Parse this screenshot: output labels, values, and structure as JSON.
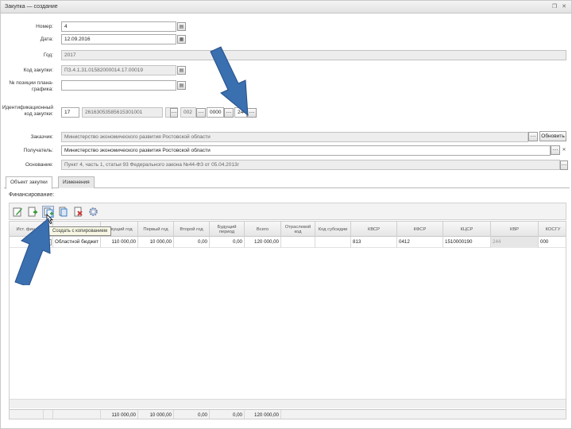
{
  "window": {
    "title": "Закупка — создание",
    "restore_glyph": "❐",
    "close_glyph": "✕"
  },
  "form": {
    "number": {
      "label": "Номер:",
      "value": "4"
    },
    "date": {
      "label": "Дата:",
      "value": "12.09.2016"
    },
    "year": {
      "label": "Год:",
      "value": "2017"
    },
    "purchase_code": {
      "label": "Код закупки:",
      "value": "ПЗ.4.1.31.01582000014.17.00019"
    },
    "schedule_no": {
      "label": "№ позиции плана-графика:",
      "value": ""
    },
    "ikz": {
      "label": "Идентификационный код закупки:",
      "parts": [
        "17",
        "26163053585615301001",
        "",
        "002",
        "0000",
        "244"
      ],
      "button_glyph": "..."
    },
    "customer": {
      "label": "Заказчик:",
      "value": "Министерство экономического развития Ростовской области",
      "button_label": "Обновить"
    },
    "recipient": {
      "label": "Получатель:",
      "value": "Министерство экономического развития Ростовской области"
    },
    "basis": {
      "label": "Основание:",
      "value": "Пункт 4, часть 1, статьи 93 Федерального закона №44-ФЗ от 05.04.2013г"
    }
  },
  "tabs": [
    {
      "label": "Объект закупки",
      "active": true
    },
    {
      "label": "Изменения",
      "active": false
    }
  ],
  "financing": {
    "section_title": "Финансирование:",
    "toolbar": [
      {
        "name": "edit-icon",
        "color": "#3b9a3b"
      },
      {
        "name": "add-icon",
        "color": "#3b9a3b"
      },
      {
        "name": "copy-create-icon",
        "color": "#3a7fc4"
      },
      {
        "name": "document-icon",
        "color": "#3a7fc4"
      },
      {
        "name": "delete-icon",
        "color": "#c43a3a"
      },
      {
        "name": "settings-icon",
        "color": "#6a7fa8"
      }
    ],
    "tooltip": "Создать с копированием",
    "columns": [
      "Ист. фин.",
      "",
      "",
      "Текущий год",
      "Первый год",
      "Второй год",
      "Будущий период",
      "Всего",
      "Отраслевой код",
      "Код субсидии",
      "КВСР",
      "КФСР",
      "КЦСР",
      "КВР",
      "КОСГУ"
    ],
    "rows": [
      {
        "source": "",
        "funding": "Областной бюджет",
        "current_year": "110 000,00",
        "first_year": "10 000,00",
        "second_year": "0,00",
        "future": "0,00",
        "total": "120 000,00",
        "sector_code": "",
        "subsidy_code": "",
        "kvsr": "813",
        "kfsr": "0412",
        "kcsr": "1510000190",
        "kvr": "244",
        "kosgu": "000"
      }
    ],
    "totals": {
      "current_year": "110 000,00",
      "first_year": "10 000,00",
      "second_year": "0,00",
      "future": "0,00",
      "total": "120 000,00"
    }
  },
  "annotation_color": "#3a6fb0"
}
